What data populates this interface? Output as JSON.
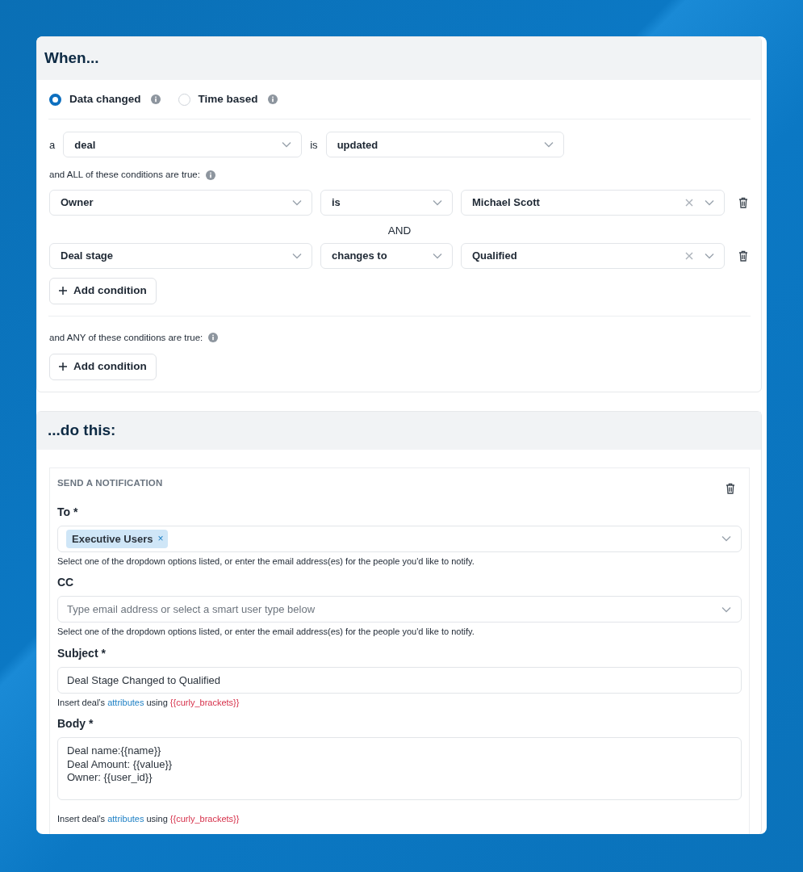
{
  "trigger": {
    "title": "When...",
    "types": [
      {
        "label": "Data changed",
        "selected": true
      },
      {
        "label": "Time based",
        "selected": false
      }
    ],
    "object_prefix": "a",
    "object": "deal",
    "verb": "is",
    "event": "updated",
    "all_label": "and ALL of these conditions are true:",
    "all_conditions": [
      {
        "field": "Owner",
        "operator": "is",
        "value": "Michael Scott"
      },
      {
        "field": "Deal stage",
        "operator": "changes to",
        "value": "Qualified"
      }
    ],
    "joiner": "AND",
    "all_add": "Add condition",
    "any_label": "and ANY of these conditions are true:",
    "any_add": "Add condition"
  },
  "actions": {
    "title": "...do this:",
    "heading": "SEND A NOTIFICATION",
    "fields": [
      {
        "kind": "tags",
        "label": "To *",
        "tags": [
          {
            "label": "Executive Users",
            "remove": "×"
          }
        ],
        "help": "Select one of the dropdown options listed, or enter the email address(es) for the people you'd like to notify."
      },
      {
        "kind": "select",
        "label": "CC",
        "placeholder": "Type email address or select a smart user type below",
        "help": "Select one of the dropdown options listed, or enter the email address(es) for the people you'd like to notify."
      },
      {
        "kind": "input",
        "label": "Subject *",
        "value": "Deal Stage Changed to Qualified",
        "help": {
          "before": "Insert deal’s",
          "link": "attributes",
          "middle": "using",
          "code": "{{curly_brackets}}"
        }
      },
      {
        "kind": "textarea",
        "label": "Body *",
        "value": "Deal name:{{name}}\nDeal Amount: {{value}}\nOwner: {{user_id}}",
        "help": {
          "before": "Insert deal’s",
          "link": "attributes",
          "middle": "using",
          "code": "{{curly_brackets}}"
        }
      }
    ]
  }
}
